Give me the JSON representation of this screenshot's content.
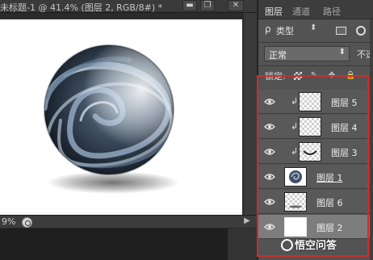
{
  "document": {
    "title": "未标题-1 @ 41.4% (图层 2, RGB/8#) *",
    "minimize_label": "▬",
    "maximize_label": "❐",
    "close_label": "✕",
    "zoom": "9%",
    "status_arrow": "▶"
  },
  "panel": {
    "tabs": [
      {
        "label": "图层",
        "active": true
      },
      {
        "label": "通道",
        "active": false
      },
      {
        "label": "路径",
        "active": false
      }
    ],
    "filter": {
      "search_glyph": "ρ",
      "kind_label": "类型",
      "arrows": "⬍"
    },
    "blend_mode": "正常",
    "blend_arrows": "⬍",
    "opacity_label": "不透",
    "lock_label": "锁定:",
    "layers": [
      {
        "name": "图层 5",
        "clipped": true,
        "thumb": "checker"
      },
      {
        "name": "图层 4",
        "clipped": true,
        "thumb": "checker"
      },
      {
        "name": "图层 3",
        "clipped": true,
        "thumb": "smile"
      },
      {
        "name": "图层 1",
        "clipped": false,
        "thumb": "sphere"
      },
      {
        "name": "图层 6",
        "clipped": false,
        "thumb": "checker"
      },
      {
        "name": "图层 2",
        "clipped": false,
        "thumb": "white",
        "selected": true
      }
    ]
  },
  "watermark": {
    "text": "悟空问答"
  },
  "colors": {
    "highlight_box": "#d32a2a",
    "selected_row": "#7d7d7d"
  }
}
